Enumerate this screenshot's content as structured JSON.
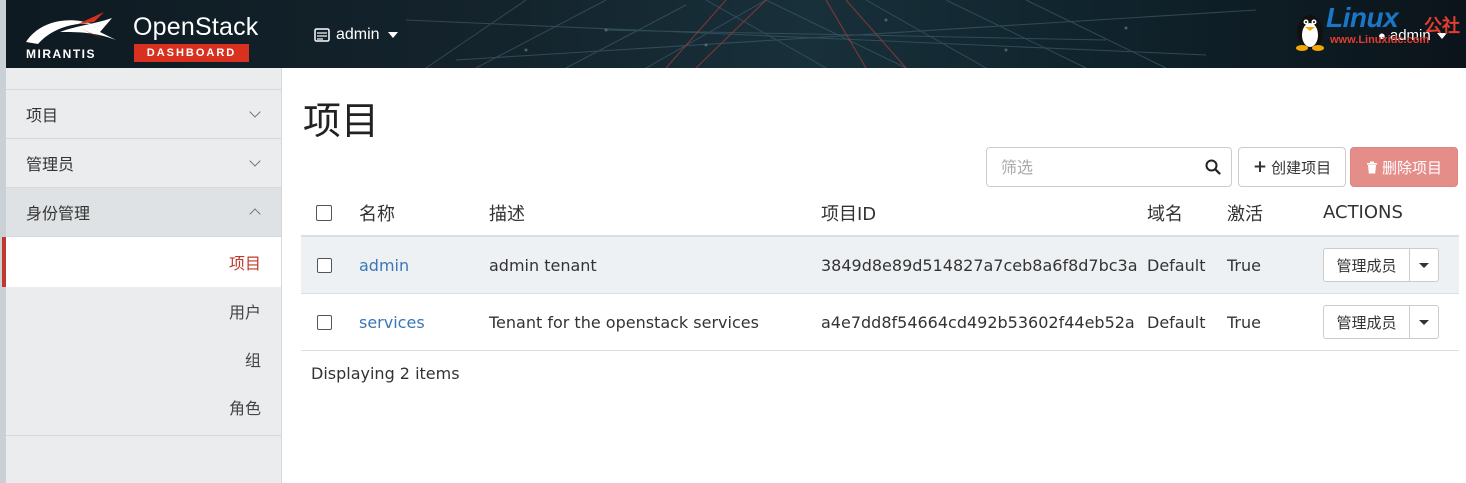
{
  "header": {
    "brand": "MIRANTIS",
    "title": "OpenStack",
    "subtitle": "DASHBOARD",
    "project_switch": "admin",
    "user_menu": "admin",
    "watermark": {
      "text": "Linux",
      "cn": "公社",
      "url": "www.Linuxidc.com"
    }
  },
  "sidebar": {
    "groups": [
      {
        "label": "项目",
        "expanded": false
      },
      {
        "label": "管理员",
        "expanded": false
      },
      {
        "label": "身份管理",
        "expanded": true
      }
    ],
    "identity_items": [
      {
        "label": "项目",
        "active": true
      },
      {
        "label": "用户",
        "active": false
      },
      {
        "label": "组",
        "active": false
      },
      {
        "label": "角色",
        "active": false
      }
    ]
  },
  "main": {
    "title": "项目",
    "filter_placeholder": "筛选",
    "create_button": "创建项目",
    "delete_button": "删除项目",
    "columns": {
      "name": "名称",
      "description": "描述",
      "id": "项目ID",
      "domain": "域名",
      "active": "激活",
      "actions": "ACTIONS"
    },
    "rows": [
      {
        "name": "admin",
        "description": "admin tenant",
        "id": "3849d8e89d514827a7ceb8a6f8d7bc3a",
        "domain": "Default",
        "active": "True",
        "action": "管理成员"
      },
      {
        "name": "services",
        "description": "Tenant for the openstack services",
        "id": "a4e7dd8f54664cd492b53602f44eb52a",
        "domain": "Default",
        "active": "True",
        "action": "管理成员"
      }
    ],
    "footer": "Displaying 2 items"
  },
  "colors": {
    "accent": "#c0392b",
    "link": "#3a78b5",
    "danger_button": "#e58d89",
    "header_bg": "#14242d"
  }
}
